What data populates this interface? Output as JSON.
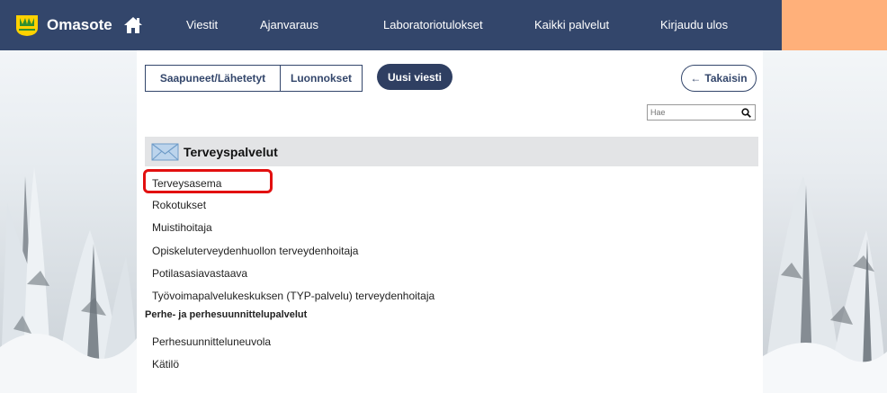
{
  "header": {
    "brand": "Omasote",
    "colors": {
      "nav_bg": "#33466b",
      "accent": "#ffb07a"
    },
    "nav": [
      "Viestit",
      "Ajanvaraus",
      "Laboratoriotulokset",
      "Kaikki palvelut",
      "Kirjaudu ulos"
    ]
  },
  "toolbar": {
    "inbox_label": "Saapuneet/Lähetetyt",
    "drafts_label": "Luonnokset",
    "new_message_label": "Uusi viesti",
    "back_label": "Takaisin",
    "back_arrow": "←"
  },
  "search": {
    "placeholder": "Hae",
    "value": ""
  },
  "section": {
    "title": "Terveyspalvelut",
    "items": [
      "Terveysasema",
      "Rokotukset",
      "Muistihoitaja",
      "Opiskeluterveydenhuollon terveydenhoitaja",
      "Potilasasiavastaava",
      "Työvoimapalvelukeskuksen (TYP-palvelu) terveydenhoitaja"
    ]
  },
  "group": {
    "title": "Perhe- ja perhesuunnittelupalvelut",
    "items": [
      "Perhesuunnitteluneuvola",
      "Kätilö"
    ]
  },
  "highlight_color": "#e21010"
}
